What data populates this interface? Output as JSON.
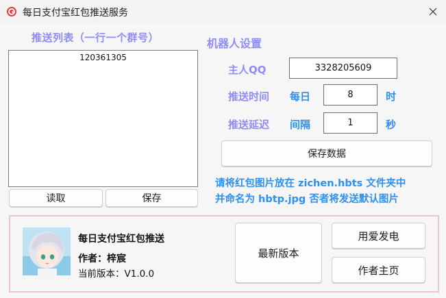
{
  "window": {
    "title": "每日支付宝红包推送服务",
    "icon": "app-ring-icon",
    "close_icon": "close-icon"
  },
  "push_list": {
    "title": "推送列表（一行一个群号）",
    "items": [
      "120361305"
    ],
    "read_button": "读取",
    "save_button": "保存"
  },
  "robot": {
    "title": "机器人设置",
    "owner_qq_label": "主人QQ",
    "owner_qq_value": "3328205609",
    "push_time_label": "推送时间",
    "push_time_prefix": "每日",
    "push_time_value": "8",
    "push_time_unit": "时",
    "push_delay_label": "推送延迟",
    "push_delay_prefix": "间隔",
    "push_delay_value": "1",
    "push_delay_unit": "秒",
    "save_data_button": "保存数据"
  },
  "note": {
    "line1": "请将红包图片放在 zichen.hbts 文件夹中",
    "line2": "并命名为 hbtp.jpg 否者将发送默认图片"
  },
  "about": {
    "avatar_icon": "anime-avatar",
    "app_name": "每日支付宝红包推送",
    "author": "作者：梓宸",
    "version": "当前版本：V1.0.0",
    "latest_button": "最新版本",
    "donate_button": "用爱发电",
    "homepage_button": "作者主页"
  },
  "colors": {
    "label_purple": "#8f8cf5",
    "label_blue": "#2e90f0",
    "about_border": "#f0c4c4",
    "app_icon": "#e23b3b"
  }
}
